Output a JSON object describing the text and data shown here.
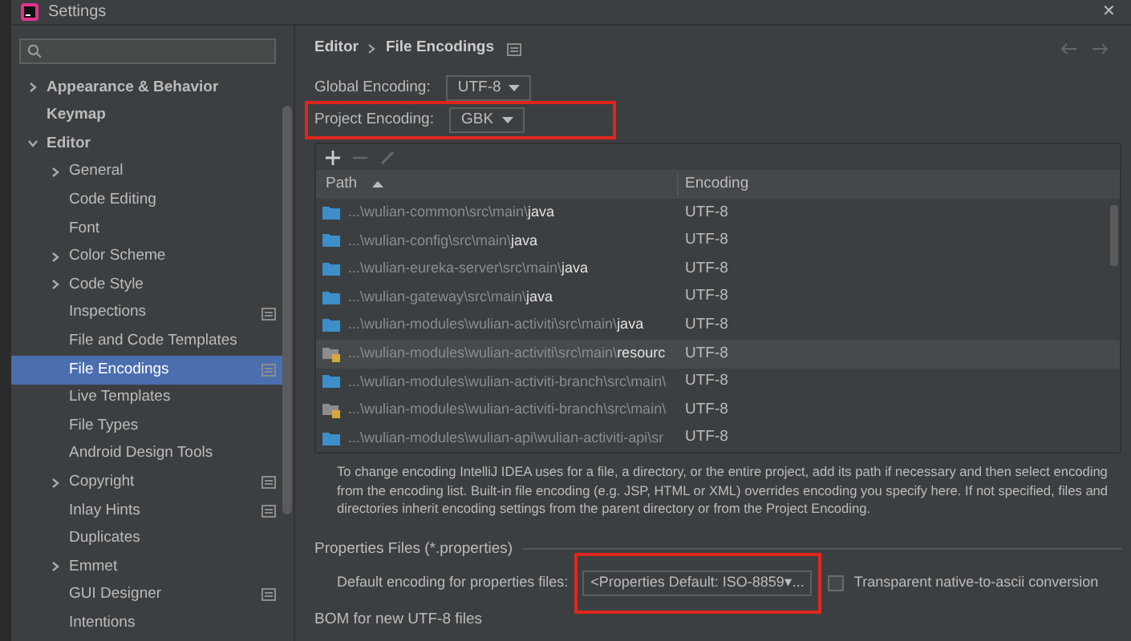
{
  "window": {
    "title": "Settings",
    "close": "✕"
  },
  "sidebar": {
    "items": [
      {
        "label": "Appearance & Behavior",
        "expanded": false,
        "selected": false
      },
      {
        "label": "Keymap",
        "selected": false
      },
      {
        "label": "Editor",
        "expanded": true,
        "selected": false,
        "children": [
          {
            "label": "General",
            "expanded": false,
            "selected": false,
            "scoped": false
          },
          {
            "label": "Code Editing",
            "selected": false,
            "scoped": false
          },
          {
            "label": "Font",
            "selected": false,
            "scoped": false
          },
          {
            "label": "Color Scheme",
            "expanded": false,
            "selected": false,
            "scoped": false
          },
          {
            "label": "Code Style",
            "expanded": false,
            "selected": false,
            "scoped": false
          },
          {
            "label": "Inspections",
            "selected": false,
            "scoped": true
          },
          {
            "label": "File and Code Templates",
            "selected": false,
            "scoped": false
          },
          {
            "label": "File Encodings",
            "selected": true,
            "scoped": true
          },
          {
            "label": "Live Templates",
            "selected": false,
            "scoped": false
          },
          {
            "label": "File Types",
            "selected": false,
            "scoped": false
          },
          {
            "label": "Android Design Tools",
            "selected": false,
            "scoped": false
          },
          {
            "label": "Copyright",
            "expanded": false,
            "selected": false,
            "scoped": true
          },
          {
            "label": "Inlay Hints",
            "selected": false,
            "scoped": true
          },
          {
            "label": "Duplicates",
            "selected": false,
            "scoped": false
          },
          {
            "label": "Emmet",
            "expanded": false,
            "selected": false,
            "scoped": false
          },
          {
            "label": "GUI Designer",
            "selected": false,
            "scoped": true
          },
          {
            "label": "Intentions",
            "selected": false,
            "scoped": false
          }
        ]
      }
    ]
  },
  "breadcrumb": [
    "Editor",
    "File Encodings"
  ],
  "encodings": [
    {
      "label": "Global Encoding:",
      "value": "UTF-8",
      "highlighted": false
    },
    {
      "label": "Project Encoding:",
      "value": "GBK",
      "highlighted": true
    }
  ],
  "table": {
    "columns": [
      {
        "label": "Path",
        "sorted": true
      },
      {
        "label": "Encoding",
        "sorted": false
      }
    ],
    "rows": [
      {
        "kind": "source",
        "path": "...\\wulian-common\\src\\main\\**java**",
        "encoding": "UTF-8",
        "selected": false
      },
      {
        "kind": "source",
        "path": "...\\wulian-config\\src\\main\\**java**",
        "encoding": "UTF-8",
        "selected": false
      },
      {
        "kind": "source",
        "path": "...\\wulian-eureka-server\\src\\main\\**java**",
        "encoding": "UTF-8",
        "selected": false
      },
      {
        "kind": "source",
        "path": "...\\wulian-gateway\\src\\main\\**java**",
        "encoding": "UTF-8",
        "selected": false
      },
      {
        "kind": "source",
        "path": "...\\wulian-modules\\wulian-activiti\\src\\main\\**java**",
        "encoding": "UTF-8",
        "selected": false
      },
      {
        "kind": "resource",
        "path": "...\\wulian-modules\\wulian-activiti\\src\\main\\**resourc**",
        "encoding": "UTF-8",
        "selected": true
      },
      {
        "kind": "source",
        "path": "...\\wulian-modules\\wulian-activiti-branch\\src\\main\\",
        "encoding": "UTF-8",
        "selected": false
      },
      {
        "kind": "resource",
        "path": "...\\wulian-modules\\wulian-activiti-branch\\src\\main\\",
        "encoding": "UTF-8",
        "selected": false
      },
      {
        "kind": "source",
        "path": "...\\wulian-modules\\wulian-api\\wulian-activiti-api\\sr",
        "encoding": "UTF-8",
        "selected": false
      }
    ]
  },
  "description": "To change encoding IntelliJ IDEA uses for a file, a directory, or the entire project, add its path if necessary and then select encoding from the encoding list. Built-in file encoding (e.g. JSP, HTML or XML) overrides encoding you specify here. If not specified, files and directories inherit encoding settings from the parent directory or from the Project Encoding.",
  "properties": {
    "title": "Properties Files (*.properties)",
    "label": "Default encoding for properties files:",
    "value": "<Properties Default: ISO-8859▾...",
    "highlighted": true,
    "checkbox": {
      "label": "Transparent native-to-ascii conversion",
      "checked": false
    }
  },
  "bom": {
    "title": "BOM for new UTF-8 files"
  }
}
